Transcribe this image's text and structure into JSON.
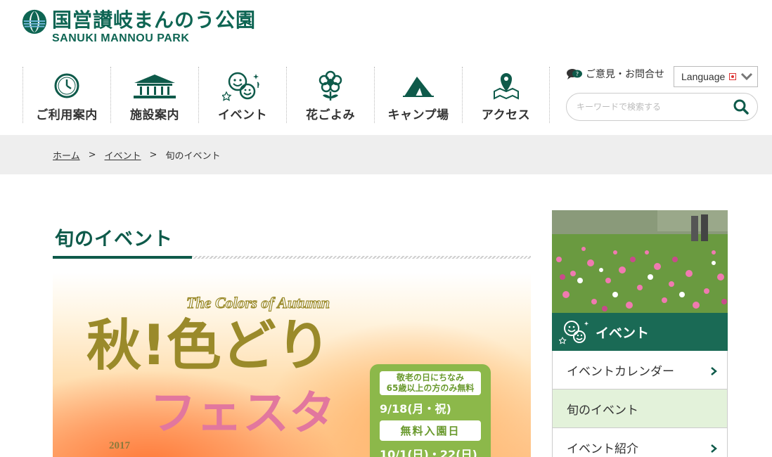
{
  "header": {
    "logo_ja": "国営讃岐まんのう公園",
    "logo_en": "SANUKI MANNOU PARK",
    "contact_label": "ご意見・お問合せ",
    "language_label": "Language",
    "search_placeholder": "キーワードで検索する"
  },
  "nav": {
    "items": [
      {
        "label": "ご利用案内",
        "icon": "clock-icon"
      },
      {
        "label": "施設案内",
        "icon": "building-icon"
      },
      {
        "label": "イベント",
        "icon": "smiley-faces-icon"
      },
      {
        "label": "花ごよみ",
        "icon": "flower-icon"
      },
      {
        "label": "キャンプ場",
        "icon": "tent-icon"
      },
      {
        "label": "アクセス",
        "icon": "map-pin-icon"
      }
    ]
  },
  "breadcrumb": {
    "home": "ホーム",
    "events": "イベント",
    "current": "旬のイベント",
    "separator": ">"
  },
  "main": {
    "title": "旬のイベント",
    "banner": {
      "subtitle_en": "The Colors of Autumn",
      "title_line1": "秋!色どり",
      "title_line2": "フェスタ",
      "year": "2017",
      "promo_note_line1": "敬老の日にちなみ",
      "promo_note_line2": "65歳以上の方のみ無料",
      "promo_date1": "9/18(月・祝)",
      "promo_free": "無料入園日",
      "promo_date2": "10/1(日)・22(日)"
    }
  },
  "sidebar": {
    "heading": "イベント",
    "items": [
      {
        "label": "イベントカレンダー",
        "active": false,
        "arrow": true
      },
      {
        "label": "旬のイベント",
        "active": true,
        "arrow": false
      },
      {
        "label": "イベント紹介",
        "active": false,
        "arrow": true
      }
    ]
  },
  "colors": {
    "brand_green": "#0e5a4a",
    "sidebar_head": "#1a6a55",
    "active_item_bg": "#e3f2da",
    "promo_green": "#8cb84a"
  }
}
